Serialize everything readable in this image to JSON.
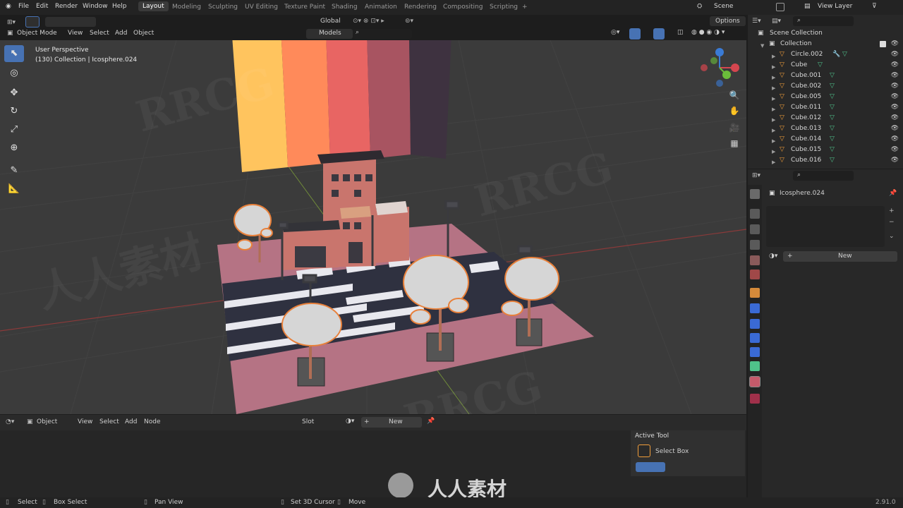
{
  "menu": [
    "File",
    "Edit",
    "Render",
    "Window",
    "Help"
  ],
  "workspaces": [
    "Layout",
    "Modeling",
    "Sculpting",
    "UV Editing",
    "Texture Paint",
    "Shading",
    "Animation",
    "Rendering",
    "Compositing",
    "Scripting",
    "+"
  ],
  "scene": "Scene",
  "view_layer": "View Layer",
  "viewport_header": {
    "mode": "Object Mode",
    "menus": [
      "View",
      "Select",
      "Add",
      "Object"
    ],
    "transform_orientation": "Global",
    "collection_filter": "Models",
    "options": "Options"
  },
  "viewport": {
    "perspective": "User Perspective",
    "info": "(130) Collection | Icosphere.024"
  },
  "outliner": {
    "root": "Scene Collection",
    "collection": "Collection",
    "items": [
      "Circle.002",
      "Cube",
      "Cube.001",
      "Cube.002",
      "Cube.005",
      "Cube.011",
      "Cube.012",
      "Cube.013",
      "Cube.014",
      "Cube.015",
      "Cube.016"
    ]
  },
  "properties": {
    "object_name": "Icosphere.024",
    "new_button": "New"
  },
  "node_editor_header": {
    "mode": "Object",
    "menus": [
      "View",
      "Select",
      "Add",
      "Node"
    ],
    "slot": "Slot",
    "new_button": "New"
  },
  "active_tool": {
    "title": "Active Tool",
    "tool_name": "Select Box"
  },
  "statusbar": {
    "select": "Select",
    "box_select": "Box Select",
    "pan_view": "Pan View",
    "set_cursor": "Set 3D Cursor",
    "move": "Move",
    "version": "2.91.0"
  },
  "watermark": {
    "overlay_text": "RRCG",
    "cn_text": "人人素材"
  },
  "colors": {
    "accent": "#4772b3",
    "selection_orange": "#f29e3a",
    "mesh_green": "#4fc28a",
    "ground_pink": "#c97a86",
    "building": "#c9756d",
    "sign_1": "#ffc45e",
    "sign_2": "#ff8a5a",
    "sign_3": "#e86563",
    "sign_4": "#a85461",
    "sign_5": "#3e3240"
  }
}
